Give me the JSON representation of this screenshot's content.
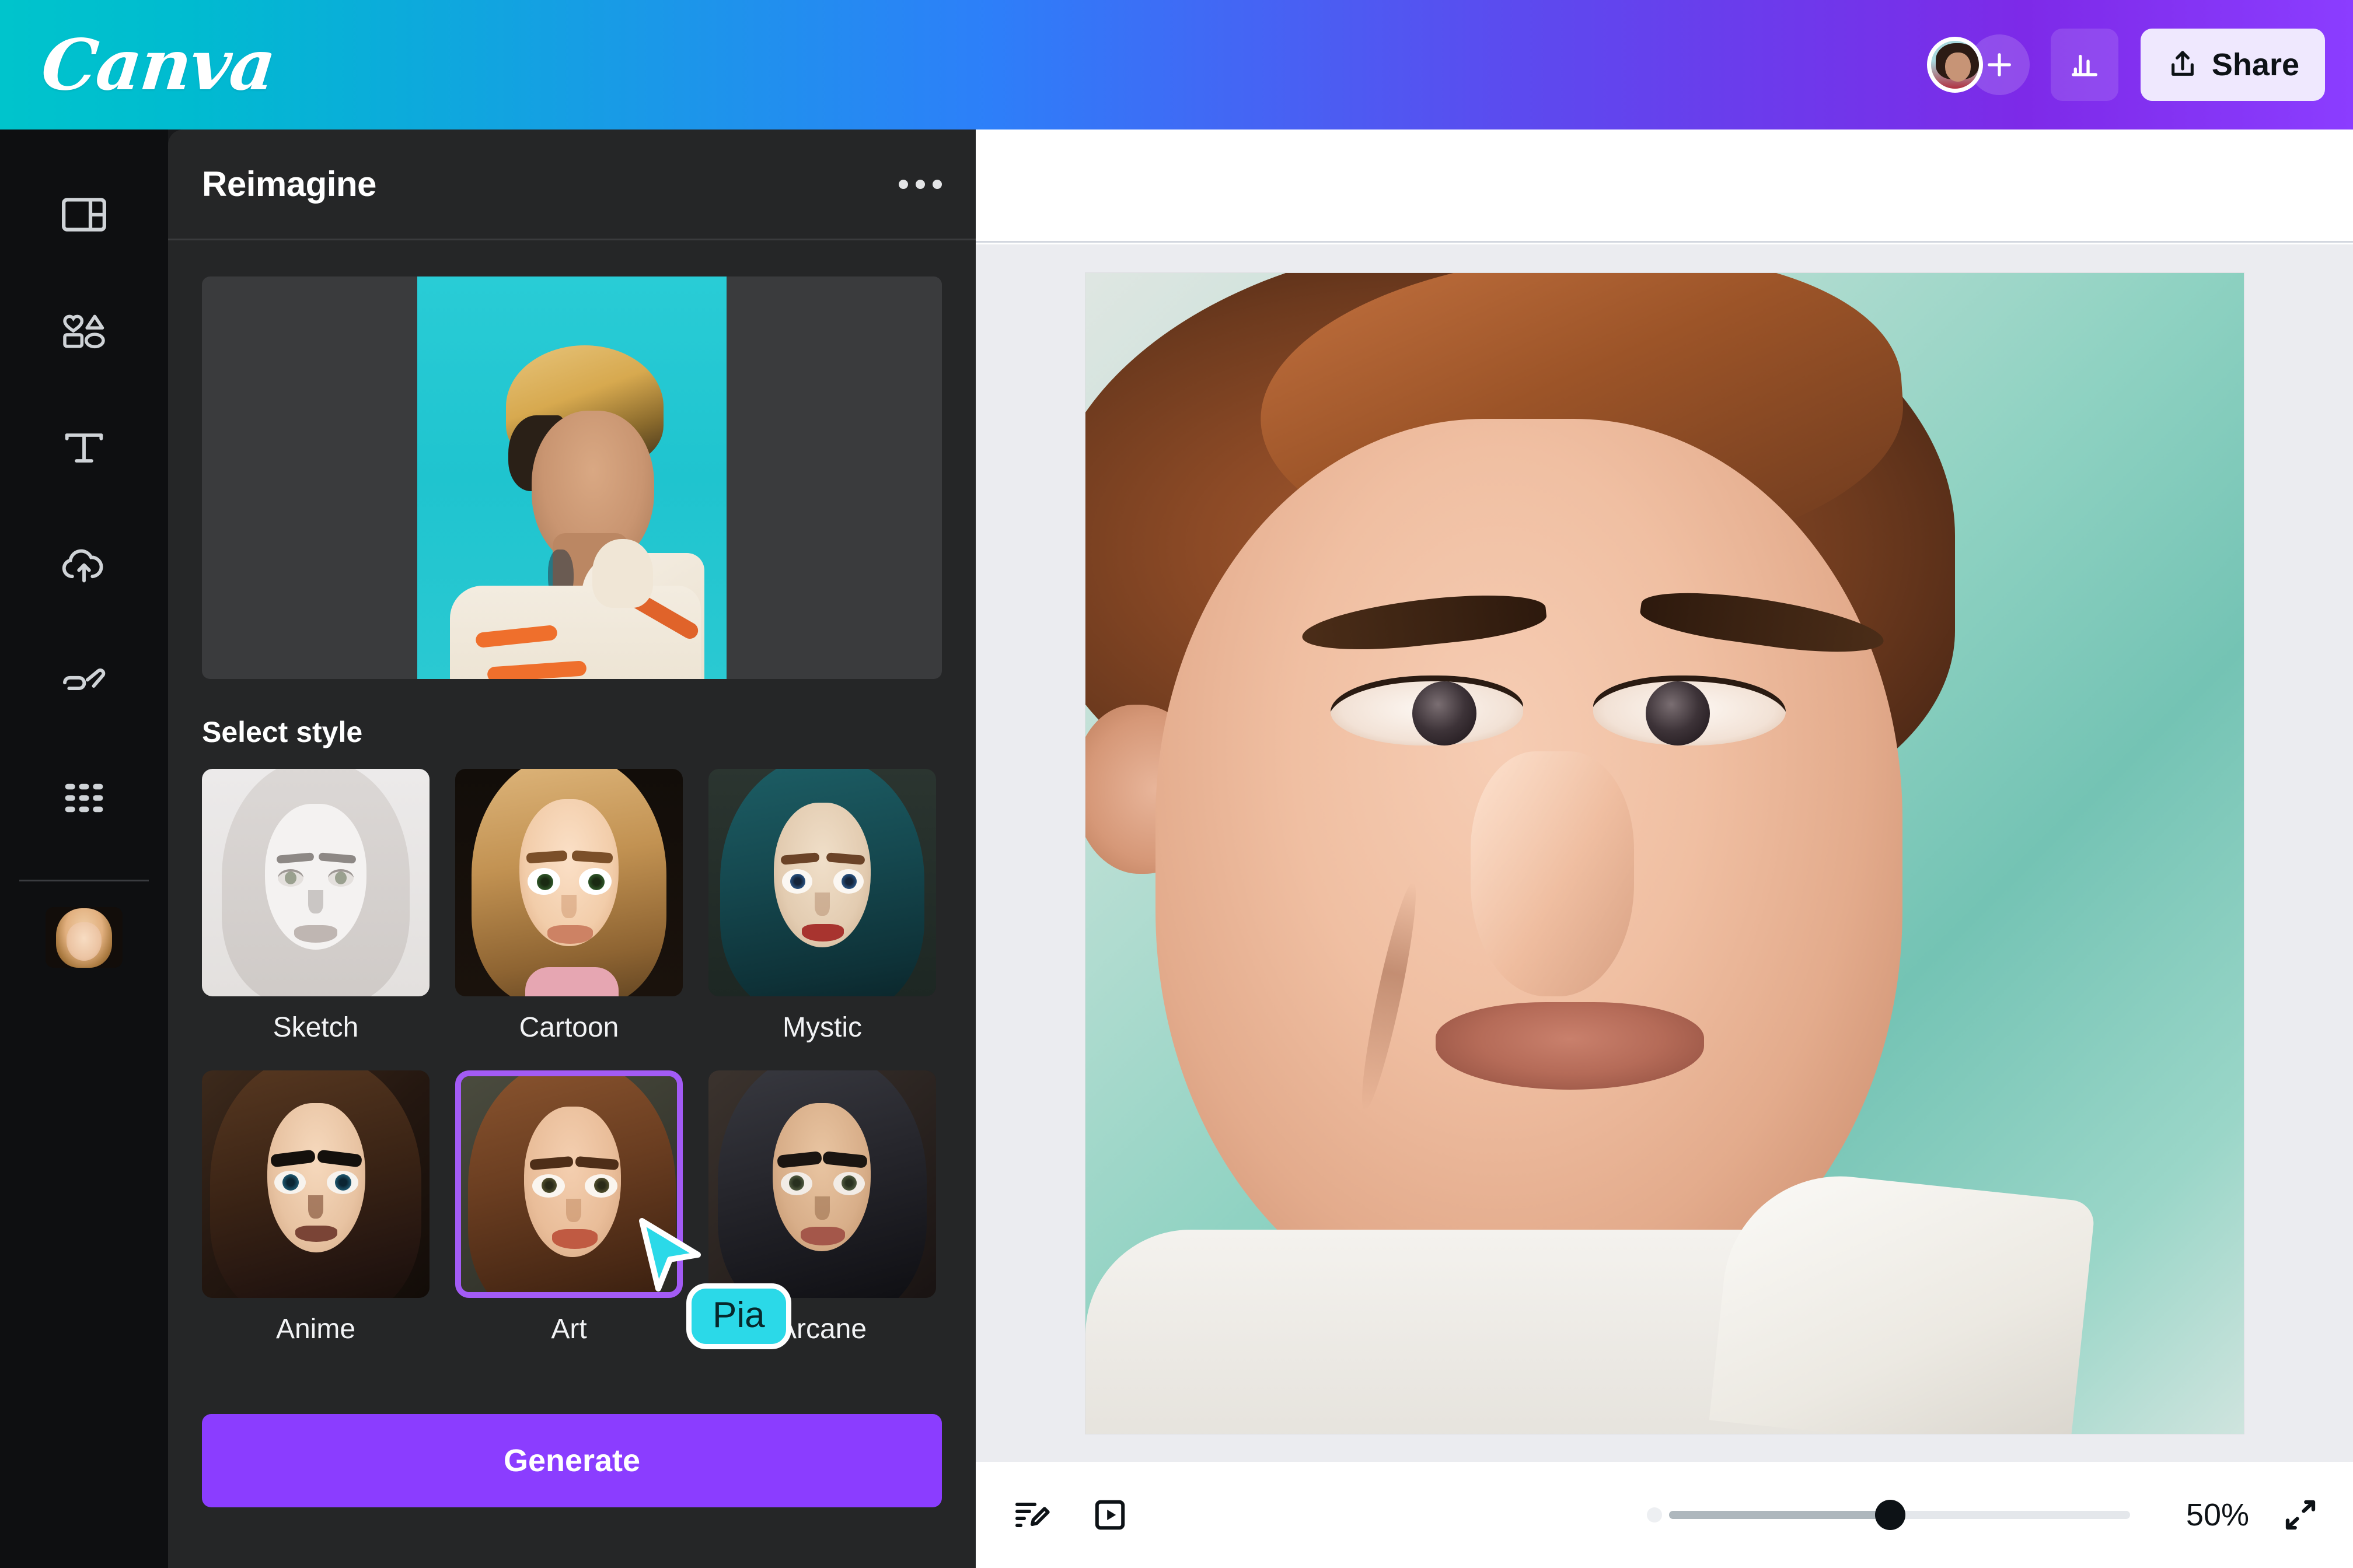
{
  "app": {
    "brand": "Canva",
    "brand_gradient": [
      "#00C4CC",
      "#2D7FF9",
      "#7D2AE8"
    ]
  },
  "topbar": {
    "avatar_name": "account-avatar",
    "add_label": "+",
    "insights_label": "insights-icon",
    "share_label": "Share"
  },
  "rail": {
    "items": [
      {
        "icon": "design-layout-icon",
        "name": "design"
      },
      {
        "icon": "elements-shapes-icon",
        "name": "elements"
      },
      {
        "icon": "text-icon",
        "name": "text"
      },
      {
        "icon": "cloud-upload-icon",
        "name": "uploads"
      },
      {
        "icon": "draw-pen-icon",
        "name": "draw"
      },
      {
        "icon": "apps-grid-icon",
        "name": "apps"
      }
    ],
    "active_app_thumb": "reimagine-app-thumbnail"
  },
  "panel": {
    "title": "Reimagine",
    "menu_icon": "more-options-icon",
    "source_image_alt": "uploaded-portrait-photo",
    "select_style_label": "Select style",
    "styles": [
      {
        "label": "Sketch",
        "selected": false
      },
      {
        "label": "Cartoon",
        "selected": false
      },
      {
        "label": "Mystic",
        "selected": false
      },
      {
        "label": "Anime",
        "selected": false
      },
      {
        "label": "Art",
        "selected": true
      },
      {
        "label": "Arcane",
        "selected": false
      }
    ],
    "selected_style": "Art",
    "generate_label": "Generate",
    "accent_color": "#8B3DFF",
    "selection_border_color": "#A35BF5"
  },
  "canvas": {
    "artwork_alt": "reimagined-art-style-portrait",
    "background_color": "#EBECF0"
  },
  "bottombar": {
    "notes_icon": "notes-edit-icon",
    "present_icon": "present-play-icon",
    "zoom_value": "50%",
    "zoom_percent": 48,
    "expand_icon": "expand-diagonal-icon"
  },
  "cursor": {
    "label": "Pia",
    "color": "#2BD9E8",
    "outline": "#FFFFFF"
  }
}
